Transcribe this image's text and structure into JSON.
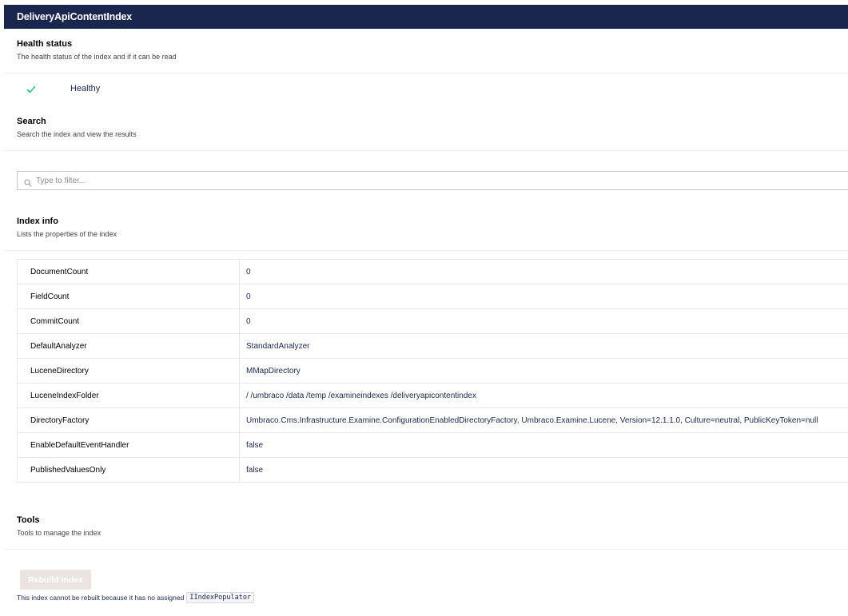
{
  "header": {
    "title": "DeliveryApiContentIndex"
  },
  "health": {
    "title": "Health status",
    "description": "The health status of the index and if it can be read",
    "status": "Healthy",
    "status_icon": "check-icon",
    "status_color": "#2bc37c"
  },
  "search": {
    "title": "Search",
    "description": "Search the index and view the results",
    "placeholder": "Type to filter...",
    "value": ""
  },
  "index_info": {
    "title": "Index info",
    "description": "Lists the properties of the index",
    "rows": [
      {
        "key": "DocumentCount",
        "value": "0"
      },
      {
        "key": "FieldCount",
        "value": "0"
      },
      {
        "key": "CommitCount",
        "value": "0"
      },
      {
        "key": "DefaultAnalyzer",
        "value": "StandardAnalyzer"
      },
      {
        "key": "LuceneDirectory",
        "value": "MMapDirectory"
      },
      {
        "key": "LuceneIndexFolder",
        "value": "/ /umbraco /data /temp /examineindexes /deliveryapicontentindex"
      },
      {
        "key": "DirectoryFactory",
        "value": "Umbraco.Cms.Infrastructure.Examine.ConfigurationEnabledDirectoryFactory, Umbraco.Examine.Lucene, Version=12.1.1.0, Culture=neutral, PublicKeyToken=null"
      },
      {
        "key": "EnableDefaultEventHandler",
        "value": "false"
      },
      {
        "key": "PublishedValuesOnly",
        "value": "false"
      }
    ]
  },
  "tools": {
    "title": "Tools",
    "description": "Tools to manage the index",
    "rebuild_label": "Rebuild index",
    "note_text": "This index cannot be rebuilt because it has no assigned",
    "note_code": "IIndexPopulator"
  }
}
